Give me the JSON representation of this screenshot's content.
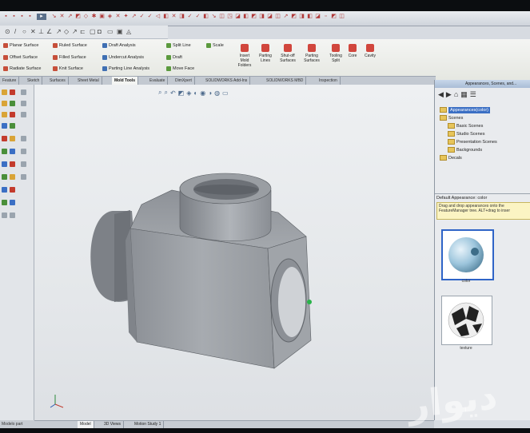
{
  "ribbon": {
    "commands": [
      {
        "id": "planar",
        "label": "Planar Surface"
      },
      {
        "id": "ruled",
        "label": "Ruled Surface"
      },
      {
        "id": "draft_analysis",
        "label": "Draft Analysis"
      },
      {
        "id": "split_line",
        "label": "Split Line"
      },
      {
        "id": "scale",
        "label": "Scale"
      },
      {
        "id": "offset",
        "label": "Offset Surface"
      },
      {
        "id": "filled",
        "label": "Filled Surface"
      },
      {
        "id": "undercut",
        "label": "Undercut Analysis"
      },
      {
        "id": "draft",
        "label": "Draft"
      },
      {
        "id": "radiate",
        "label": "Radiate Surface"
      },
      {
        "id": "knit",
        "label": "Knit Surface"
      },
      {
        "id": "parting_analysis",
        "label": "Parting Line Analysis"
      },
      {
        "id": "move_face",
        "label": "Move Face"
      }
    ],
    "big_buttons": [
      {
        "id": "insert_mold",
        "label": "Insert Mold Folders"
      },
      {
        "id": "parting_lines",
        "label": "Parting Lines"
      },
      {
        "id": "shutoff",
        "label": "Shut-off Surfaces"
      },
      {
        "id": "parting_surfaces",
        "label": "Parting Surfaces"
      },
      {
        "id": "tooling_split",
        "label": "Tooling Split"
      },
      {
        "id": "core",
        "label": "Core"
      },
      {
        "id": "cavity",
        "label": "Cavity"
      }
    ]
  },
  "tabs": [
    "Feature",
    "Sketch",
    "Surfaces",
    "Sheet Metal",
    "Mold Tools",
    "Evaluate",
    "DimXpert",
    "SOLIDWORKS Add-Ins",
    "SOLIDWORKS MBD",
    "Inspection"
  ],
  "active_tab_index": 4,
  "taskpane": {
    "title": "Appearances, Scenes, and...",
    "tree": [
      {
        "label": "Appearances(color)",
        "selected": true
      },
      {
        "label": "Scenes"
      },
      {
        "label": "Basic Scenes"
      },
      {
        "label": "Studio Scenes"
      },
      {
        "label": "Presentation Scenes"
      },
      {
        "label": "Backgrounds"
      },
      {
        "label": "Decals"
      }
    ],
    "sub_title": "Default Appearance: color",
    "tip": "Drag and drop appearances onto the FeatureManager tree. ALT+drag to inser",
    "thumb1_caption": "color",
    "thumb2_caption": "texture"
  },
  "bottom_tabs": [
    "Model",
    "3D Views",
    "Motion Study 1"
  ],
  "active_bottom_tab": 0,
  "status_text": "Modelo part",
  "watermark": "دیوار",
  "colors": {
    "accent": "#3b6fc4",
    "part": "#9ea3a8"
  }
}
